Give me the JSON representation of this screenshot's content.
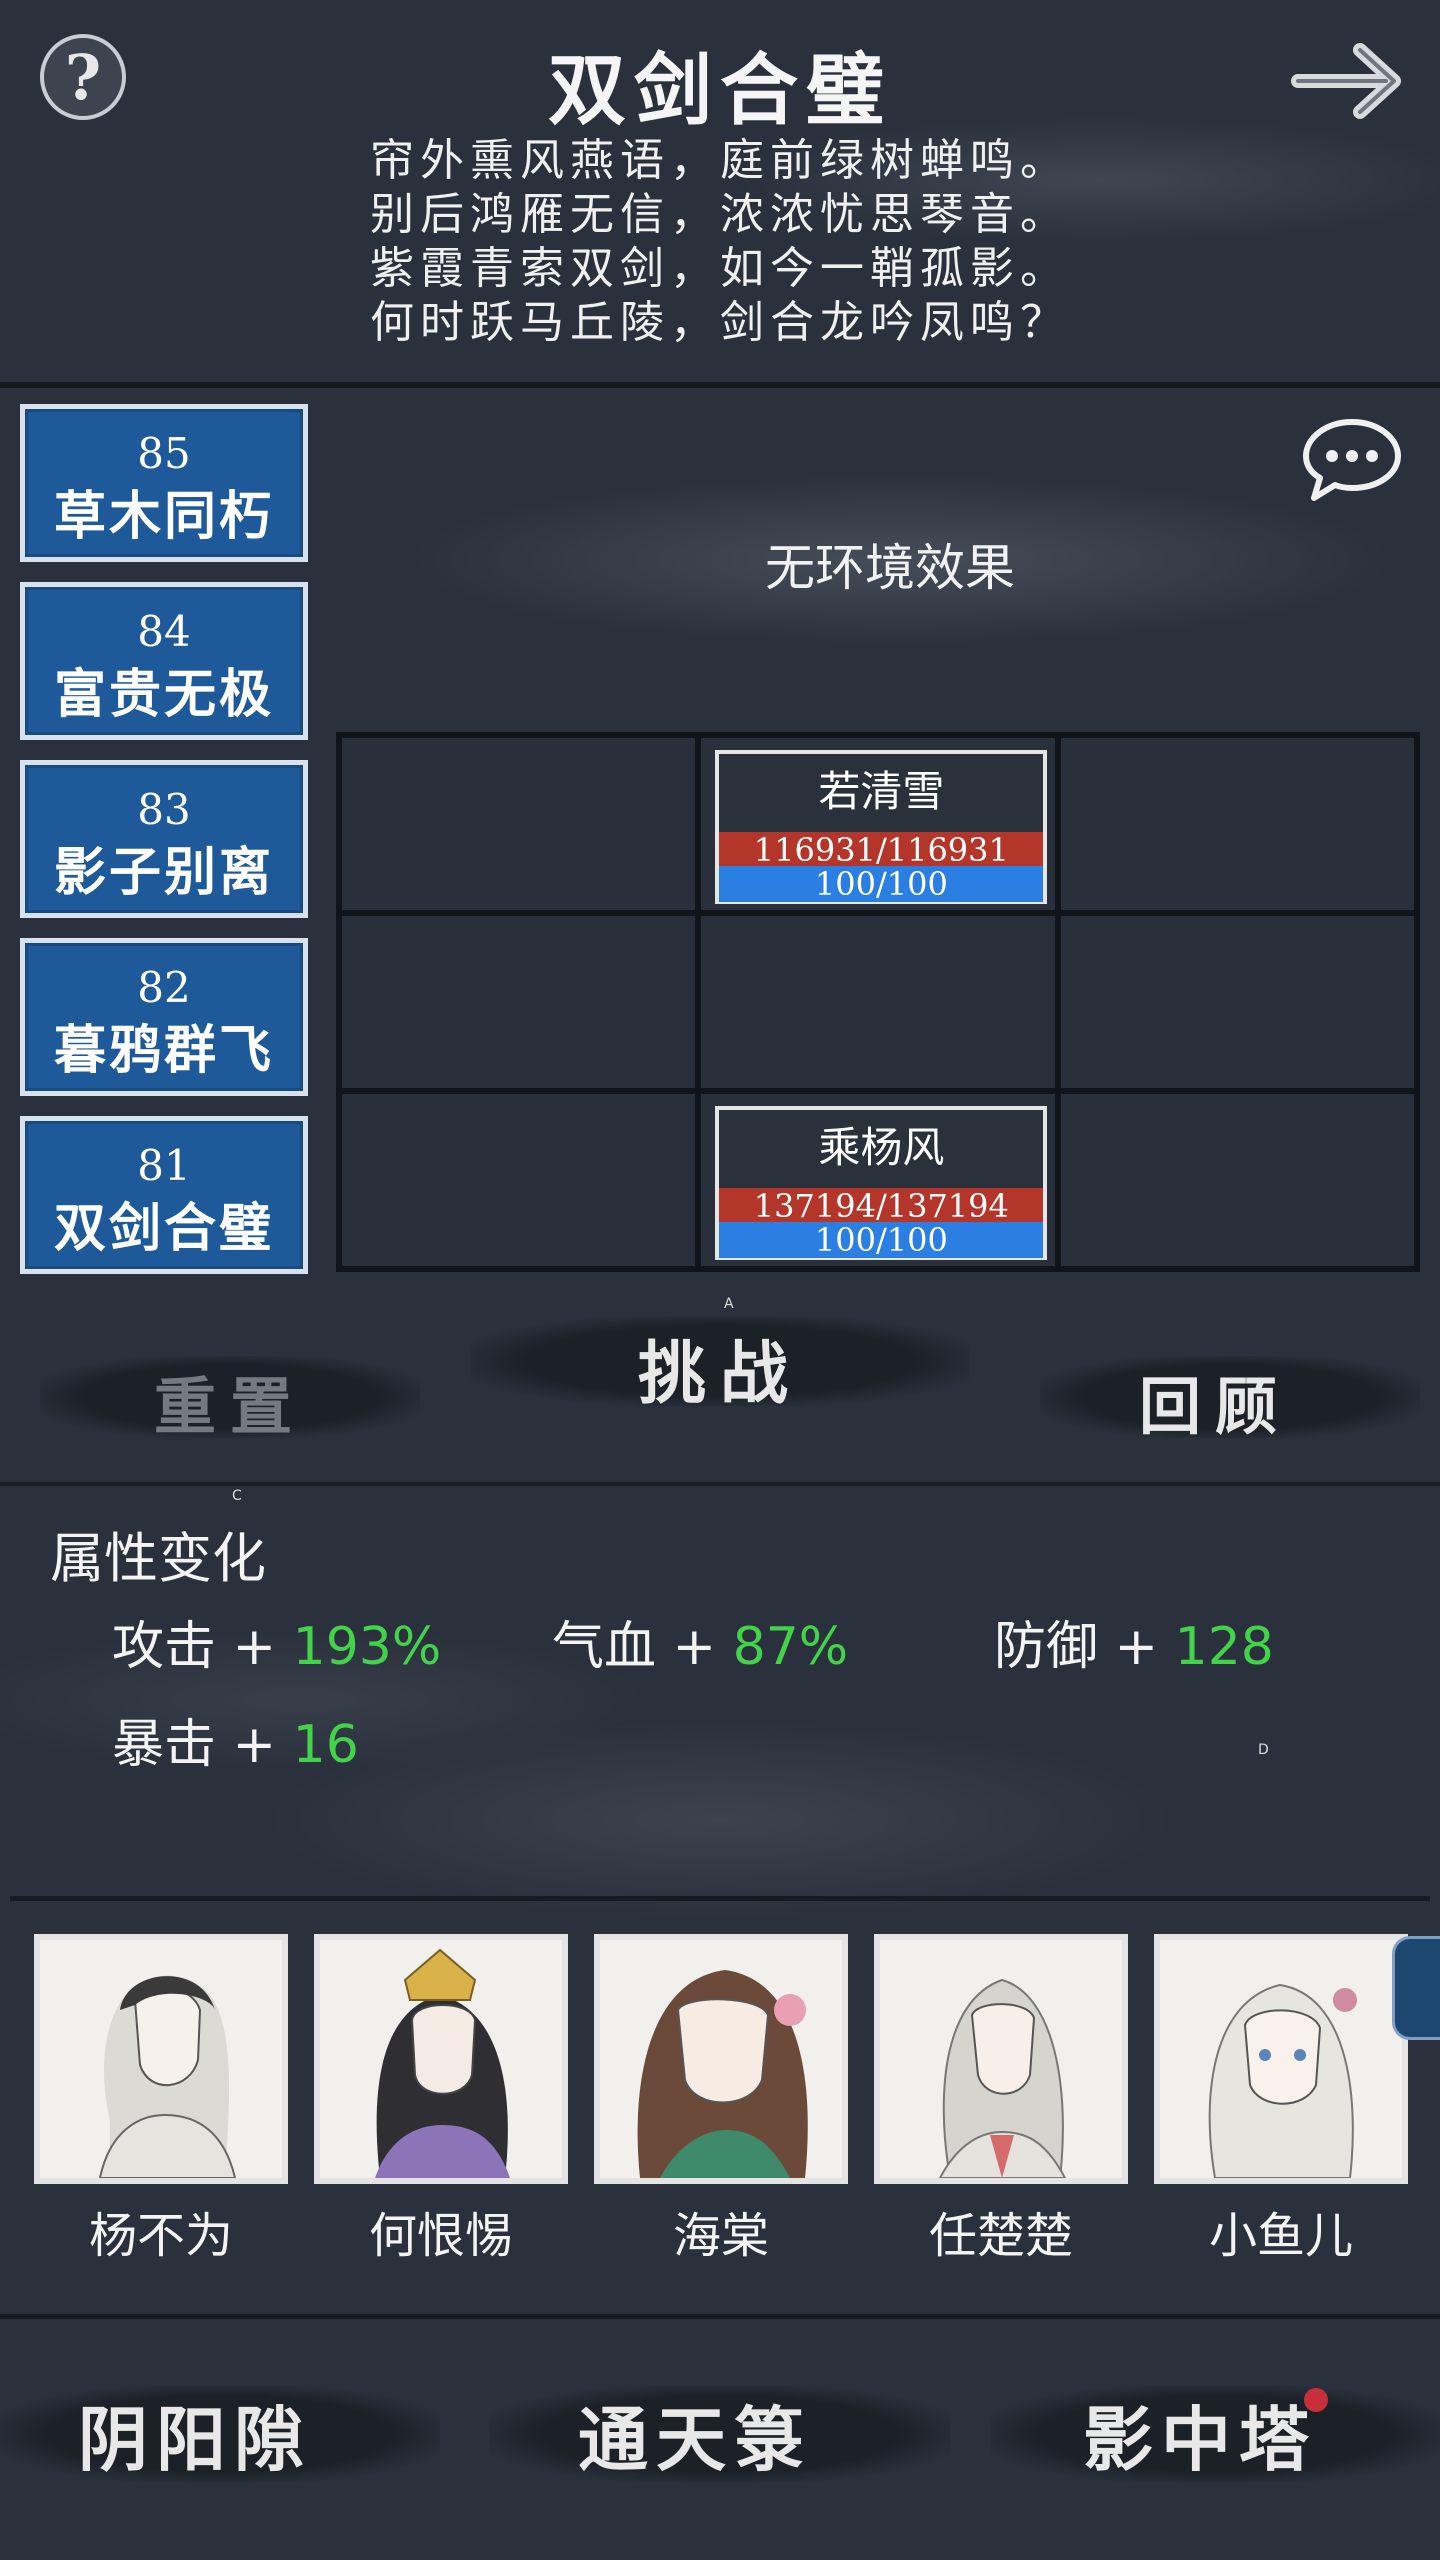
{
  "header": {
    "title": "双剑合璧",
    "poem": [
      "帘外熏风燕语，庭前绿树蝉鸣。",
      "别后鸿雁无信，浓浓忧思琴音。",
      "紫霞青索双剑，如今一鞘孤影。",
      "何时跃马丘陵，剑合龙吟凤鸣？"
    ],
    "help_icon": "?"
  },
  "levels": [
    {
      "number": "85",
      "name": "草木同朽"
    },
    {
      "number": "84",
      "name": "富贵无极"
    },
    {
      "number": "83",
      "name": "影子别离"
    },
    {
      "number": "82",
      "name": "暮鸦群飞"
    },
    {
      "number": "81",
      "name": "双剑合璧"
    }
  ],
  "environment": {
    "text": "无环境效果"
  },
  "battlefield": {
    "enemy": {
      "name": "若清雪",
      "hp": "116931/116931",
      "mp": "100/100",
      "hp_fraction": 1.0,
      "mp_fraction": 1.0
    },
    "player": {
      "name": "乘杨风",
      "hp": "137194/137194",
      "mp": "100/100",
      "hp_fraction": 1.0,
      "mp_fraction": 1.0
    }
  },
  "actions": {
    "reset": "重置",
    "challenge": "挑战",
    "review": "回顾",
    "marks": [
      "A",
      "C",
      "D"
    ]
  },
  "attributes": {
    "title": "属性变化",
    "items": [
      {
        "label": "攻击 + ",
        "value": "193%"
      },
      {
        "label": "气血 + ",
        "value": "87%"
      },
      {
        "label": "防御 + ",
        "value": "128"
      },
      {
        "label": "暴击 + ",
        "value": "16"
      }
    ],
    "value_color": "#43d34a"
  },
  "characters": [
    {
      "name": "杨不为"
    },
    {
      "name": "何恨惕"
    },
    {
      "name": "海棠"
    },
    {
      "name": "任楚楚"
    },
    {
      "name": "小鱼儿"
    }
  ],
  "bottom_nav": {
    "items": [
      "阴阳隙",
      "通天箓",
      "影中塔"
    ],
    "notification_color": "#c7303a"
  },
  "colors": {
    "background": "#2b313c",
    "level_card": "#1e5a9a",
    "hp_bar": "#b4362b",
    "mp_bar": "#2b7fe2"
  }
}
